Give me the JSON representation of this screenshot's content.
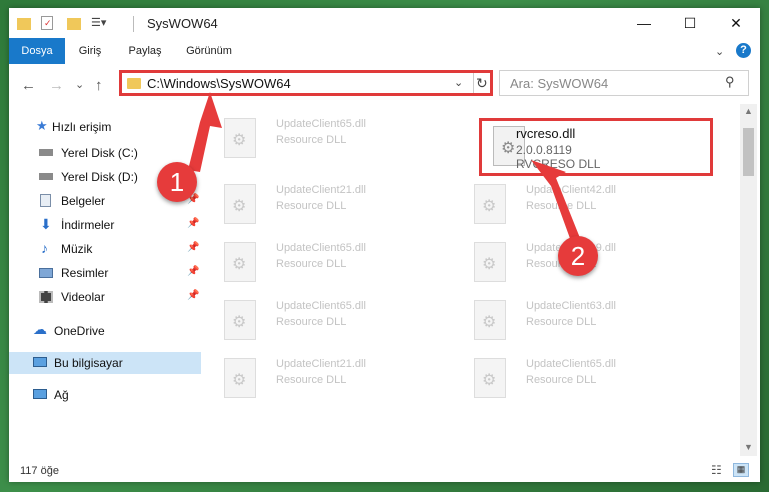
{
  "window": {
    "title": "SysWOW64",
    "controls": {
      "minimize": "—",
      "maximize": "☐",
      "close": "✕"
    }
  },
  "ribbon": {
    "tabs": [
      "Dosya",
      "Giriş",
      "Paylaş",
      "Görünüm"
    ],
    "active_tab": "Dosya",
    "expand_icon": "chevron-down",
    "help_label": "?"
  },
  "nav": {
    "back": "←",
    "forward": "→",
    "recent": "⌄",
    "up": "↑",
    "address": "C:\\Windows\\SysWOW64",
    "address_dropdown": "⌄",
    "refresh": "↻",
    "search_placeholder": "Ara: SysWOW64"
  },
  "sidebar": {
    "items": [
      {
        "label": "Hızlı erişim",
        "icon": "star-icon",
        "pinned": false
      },
      {
        "label": "Yerel Disk (C:)",
        "icon": "drive-icon",
        "pinned": false
      },
      {
        "label": "Yerel Disk (D:)",
        "icon": "drive-icon",
        "pinned": false
      },
      {
        "label": "Belgeler",
        "icon": "documents-icon",
        "pinned": true
      },
      {
        "label": "İndirmeler",
        "icon": "download-icon",
        "pinned": true
      },
      {
        "label": "Müzik",
        "icon": "music-icon",
        "pinned": true
      },
      {
        "label": "Resimler",
        "icon": "pictures-icon",
        "pinned": true
      },
      {
        "label": "Videolar",
        "icon": "video-icon",
        "pinned": true
      },
      {
        "label": "OneDrive",
        "icon": "cloud-icon",
        "pinned": false
      },
      {
        "label": "Bu bilgisayar",
        "icon": "computer-icon",
        "pinned": false,
        "selected": true
      },
      {
        "label": "Ağ",
        "icon": "network-icon",
        "pinned": false
      }
    ],
    "pin_glyph": "📌"
  },
  "files": [
    {
      "name": "UpdateClient65.dll",
      "type": "Resource DLL"
    },
    {
      "name": "rvcreso.dll",
      "version": "2.0.0.8119",
      "type": "RVCRESO DLL",
      "highlighted": true
    },
    {
      "name": "UpdateClient21.dll",
      "type": "Resource DLL"
    },
    {
      "name": "UpdateClient42.dll",
      "type": "Resource DLL"
    },
    {
      "name": "UpdateClient65.dll",
      "type": "Resource DLL"
    },
    {
      "name": "UpdateClient19.dll",
      "type": "Resource DLL"
    },
    {
      "name": "UpdateClient65.dll",
      "type": "Resource DLL"
    },
    {
      "name": "UpdateClient63.dll",
      "type": "Resource DLL"
    },
    {
      "name": "UpdateClient21.dll",
      "type": "Resource DLL"
    },
    {
      "name": "UpdateClient65.dll",
      "type": "Resource DLL"
    }
  ],
  "status": {
    "count": "117 öğe",
    "view_details": "☷",
    "view_tiles": "▦"
  },
  "annotations": {
    "step1": "1",
    "step2": "2",
    "color": "#e63b3b"
  },
  "colors": {
    "accent": "#1979ca",
    "highlight": "#e03a3a",
    "selected_bg": "#cce4f7"
  }
}
